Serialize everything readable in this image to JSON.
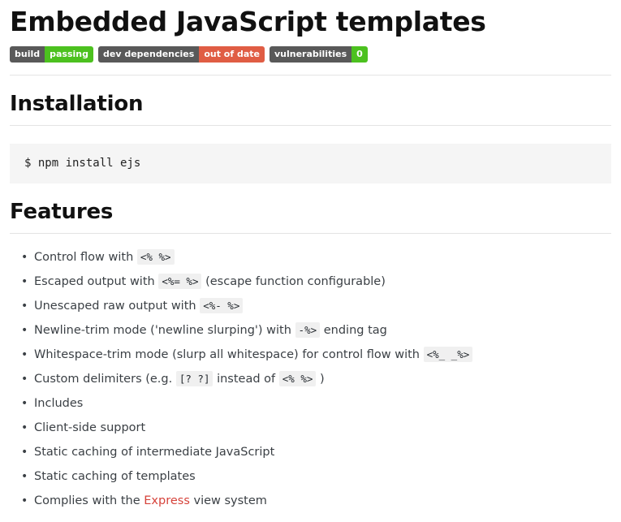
{
  "page": {
    "title": "Embedded JavaScript templates"
  },
  "badges": [
    {
      "name": "build-status-badge",
      "left": "build",
      "right": "passing",
      "left_color": "#595959",
      "right_color": "#4cc11f"
    },
    {
      "name": "dev-dependencies-badge",
      "left": "dev dependencies",
      "right": "out of date",
      "left_color": "#595959",
      "right_color": "#e05d44"
    },
    {
      "name": "vulnerabilities-badge",
      "left": "vulnerabilities",
      "right": "0",
      "left_color": "#595959",
      "right_color": "#4cc11f"
    }
  ],
  "installation": {
    "heading": "Installation",
    "command": "$ npm install ejs"
  },
  "features": {
    "heading": "Features",
    "items": [
      {
        "parts": [
          {
            "t": "text",
            "v": "Control flow with "
          },
          {
            "t": "code",
            "v": "<% %>"
          }
        ]
      },
      {
        "parts": [
          {
            "t": "text",
            "v": "Escaped output with "
          },
          {
            "t": "code",
            "v": "<%= %>"
          },
          {
            "t": "text",
            "v": " (escape function configurable)"
          }
        ]
      },
      {
        "parts": [
          {
            "t": "text",
            "v": "Unescaped raw output with "
          },
          {
            "t": "code",
            "v": "<%- %>"
          }
        ]
      },
      {
        "parts": [
          {
            "t": "text",
            "v": "Newline-trim mode ('newline slurping') with "
          },
          {
            "t": "code",
            "v": "-%>"
          },
          {
            "t": "text",
            "v": " ending tag"
          }
        ]
      },
      {
        "parts": [
          {
            "t": "text",
            "v": "Whitespace-trim mode (slurp all whitespace) for control flow with "
          },
          {
            "t": "code",
            "v": "<%_ _%>"
          }
        ]
      },
      {
        "parts": [
          {
            "t": "text",
            "v": "Custom delimiters (e.g. "
          },
          {
            "t": "code",
            "v": "[? ?]"
          },
          {
            "t": "text",
            "v": " instead of "
          },
          {
            "t": "code",
            "v": "<% %>"
          },
          {
            "t": "text",
            "v": " )"
          }
        ]
      },
      {
        "parts": [
          {
            "t": "text",
            "v": "Includes"
          }
        ]
      },
      {
        "parts": [
          {
            "t": "text",
            "v": "Client-side support"
          }
        ]
      },
      {
        "parts": [
          {
            "t": "text",
            "v": "Static caching of intermediate JavaScript"
          }
        ]
      },
      {
        "parts": [
          {
            "t": "text",
            "v": "Static caching of templates"
          }
        ]
      },
      {
        "parts": [
          {
            "t": "text",
            "v": "Complies with the "
          },
          {
            "t": "link",
            "v": "Express",
            "name": "express-link"
          },
          {
            "t": "text",
            "v": " view system"
          }
        ]
      }
    ]
  },
  "colors": {
    "link": "#d6433b",
    "rule": "#e4e4e4",
    "code_bg": "#f5f5f5",
    "inline_code_bg": "#f0f0f0",
    "text": "#3b4045",
    "heading": "#111111"
  }
}
